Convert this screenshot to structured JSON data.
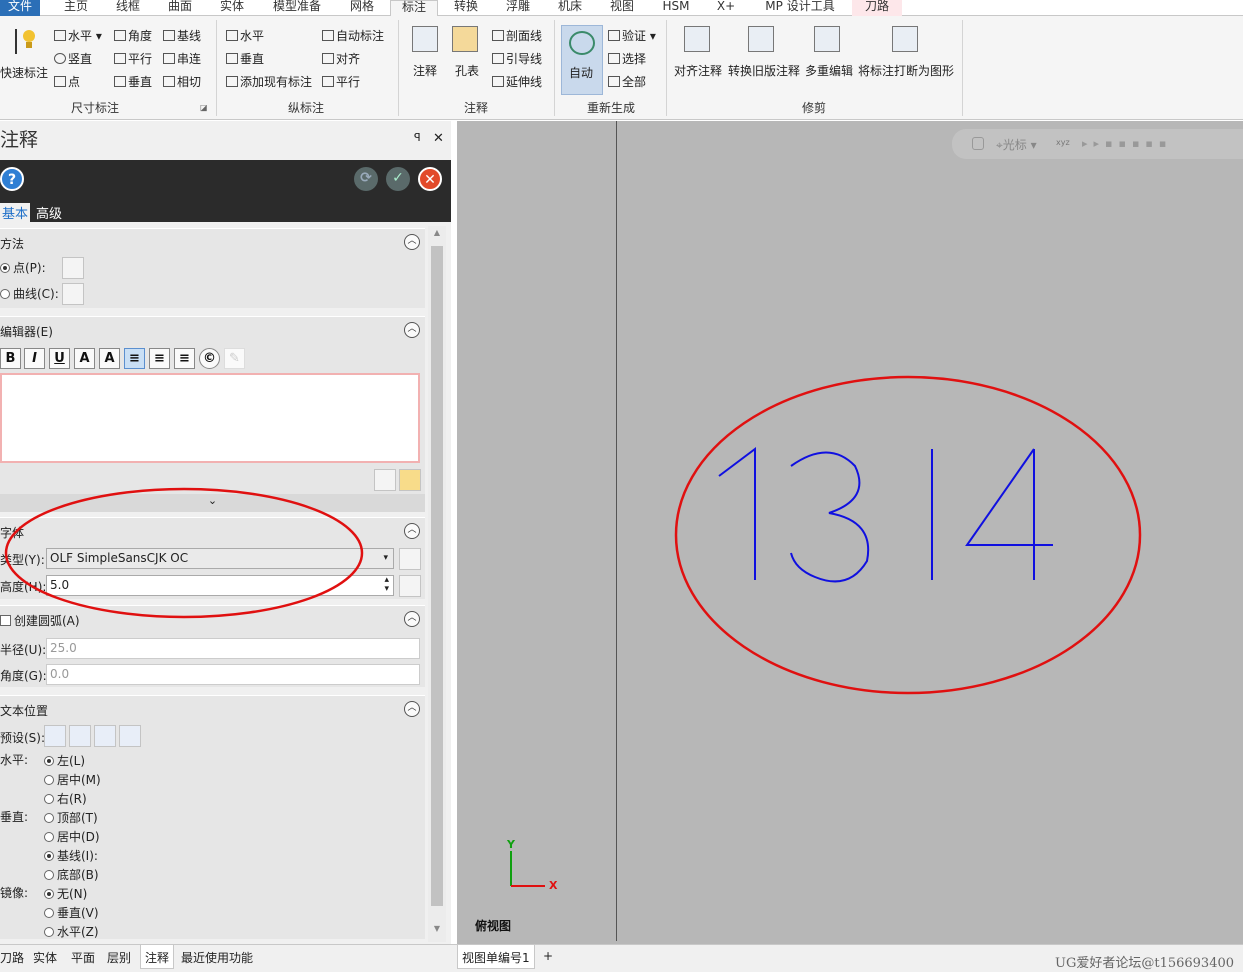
{
  "menu_tabs": [
    {
      "label": "文件"
    },
    {
      "label": "主页"
    },
    {
      "label": "线框"
    },
    {
      "label": "曲面"
    },
    {
      "label": "实体"
    },
    {
      "label": "模型准备"
    },
    {
      "label": "网格"
    },
    {
      "label": "标注"
    },
    {
      "label": "转换"
    },
    {
      "label": "浮雕"
    },
    {
      "label": "机床"
    },
    {
      "label": "视图"
    },
    {
      "label": "HSM"
    },
    {
      "label": "X+"
    },
    {
      "label": "MP 设计工具"
    },
    {
      "label": "刀路"
    }
  ],
  "ribbon": {
    "quick_dim": "快速标注",
    "dim_items": [
      "水平",
      "竖直",
      "点",
      "角度",
      "平行",
      "垂直",
      "基线",
      "串连",
      "相切"
    ],
    "group_dim": "尺寸标注",
    "ord_items": [
      "水平",
      "垂直",
      "添加现有标注",
      "自动标注",
      "对齐",
      "平行"
    ],
    "group_ord": "纵标注",
    "note": "注释",
    "hole_table": "孔表",
    "note_items": [
      "剖面线",
      "引导线",
      "延伸线"
    ],
    "group_note": "注释",
    "auto": "自动",
    "regen_items": [
      "验证",
      "选择",
      "全部"
    ],
    "group_regen": "重新生成",
    "mod_items": [
      "对齐注释",
      "转换旧版注释",
      "多重编辑",
      "将标注打断为图形"
    ],
    "group_mod": "修剪"
  },
  "panel": {
    "title": "注释",
    "pin": "ꟼ",
    "close": "✕",
    "help": "?",
    "ok": "✓",
    "cancel": "✕",
    "tab_basic": "基本",
    "tab_adv": "高级",
    "method": {
      "header": "方法",
      "point": "点(P):",
      "curve": "曲线(C):"
    },
    "editor": {
      "header": "编辑器(E)",
      "buttons": [
        "B",
        "I",
        "U",
        "A",
        "A"
      ]
    },
    "font": {
      "header": "字体",
      "type_label": "类型(Y):",
      "type_value": "OLF SimpleSansCJK OC",
      "height_label": "高度(H):",
      "height_value": "5.0"
    },
    "arc": {
      "header": "创建圆弧(A)",
      "radius_label": "半径(U):",
      "radius_value": "25.0",
      "angle_label": "角度(G):",
      "angle_value": "0.0"
    },
    "textpos": {
      "header": "文本位置",
      "preset": "预设(S):",
      "horizontal": "水平:",
      "h_opts": [
        "左(L)",
        "居中(M)",
        "右(R)"
      ],
      "vertical": "垂直:",
      "v_opts": [
        "顶部(T)",
        "居中(D)",
        "基线(I):",
        "底部(B)"
      ],
      "mirror": "镜像:",
      "m_opts": [
        "无(N)",
        "垂直(V)",
        "水平(Z)"
      ]
    }
  },
  "bottom_tabs": [
    "刀路",
    "实体",
    "平面",
    "层别",
    "注释",
    "最近使用功能"
  ],
  "view_tabs": [
    "视图单编号1",
    "+"
  ],
  "viewport": {
    "text": "1314",
    "view_name": "俯视图",
    "axis_x": "X",
    "axis_y": "Y",
    "toolbar_label": "光标"
  },
  "watermark": "UG爱好者论坛@t156693400",
  "colors": {
    "accent": "#2b6fb7",
    "annotation": "#1010e0",
    "highlight": "#e01010"
  }
}
